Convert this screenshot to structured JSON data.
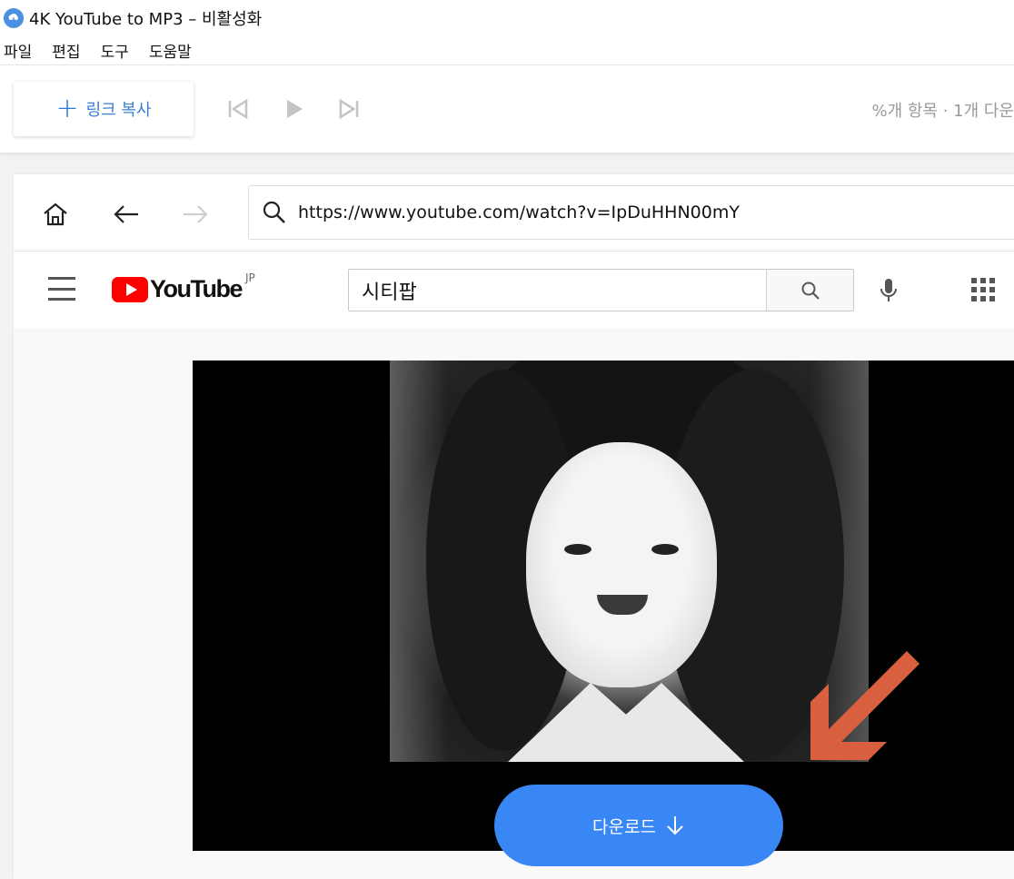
{
  "window": {
    "title": "4K YouTube to MP3 – 비활성화"
  },
  "menu": {
    "items": [
      "파일",
      "편집",
      "도구",
      "도움말"
    ]
  },
  "toolbar": {
    "paste_label": "링크 복사",
    "status_text": "%개 항목 · 1개 다운"
  },
  "browser": {
    "url": "https://www.youtube.com/watch?v=IpDuHHN00mY"
  },
  "youtube": {
    "logo_text": "YouTube",
    "country_code": "JP",
    "search_query": "시티팝"
  },
  "download_button": {
    "label": "다운로드"
  },
  "colors": {
    "accent": "#3987f5",
    "paste_accent": "#2a7ae2",
    "youtube_red": "#ff0000",
    "arrow": "#d9603f"
  }
}
